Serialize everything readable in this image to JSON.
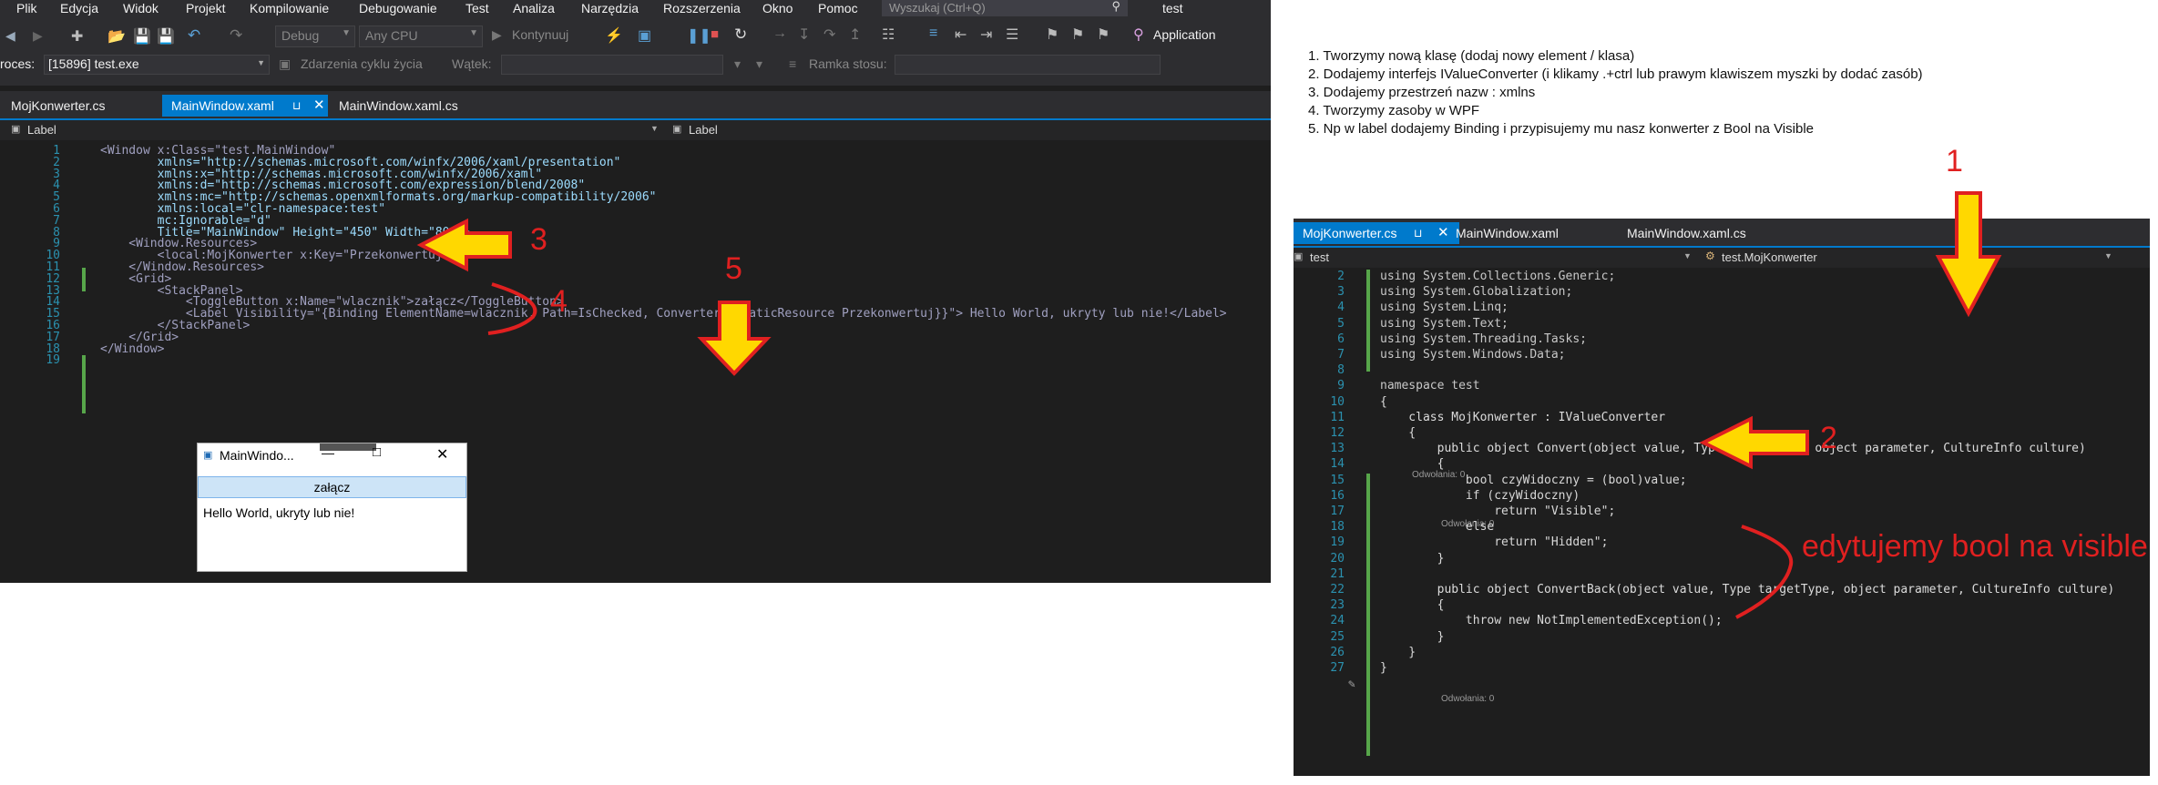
{
  "left_window": {
    "menu": [
      "Plik",
      "Edycja",
      "Widok",
      "Projekt",
      "Kompilowanie",
      "Debugowanie",
      "Test",
      "Analiza",
      "Narzędzia",
      "Rozszerzenia",
      "Okno",
      "Pomoc"
    ],
    "search_placeholder": "Wyszukaj (Ctrl+Q)",
    "solution_name": "test",
    "toolbar": {
      "config": "Debug",
      "platform": "Any CPU",
      "continue": "Kontynuuj",
      "startup": "Application"
    },
    "toolbar2": {
      "process_label": "roces:",
      "process_value": "[15896] test.exe",
      "lifecycle": "Zdarzenia cyklu życia",
      "thread_label": "Wątek:",
      "stack_frame_label": "Ramka stosu:"
    },
    "tabs": [
      "MojKonwerter.cs",
      "MainWindow.xaml",
      "MainWindow.xaml.cs"
    ],
    "active_tab": "MainWindow.xaml",
    "nav_left": "Label",
    "nav_right": "Label",
    "line_numbers": [
      "1",
      "2",
      "3",
      "4",
      "5",
      "6",
      "7",
      "8",
      "9",
      "10",
      "11",
      "12",
      "13",
      "14",
      "15",
      "16",
      "17",
      "18",
      "19"
    ],
    "code_lines": [
      "<Window x:Class=\"test.MainWindow\"",
      "        xmlns=\"http://schemas.microsoft.com/winfx/2006/xaml/presentation\"",
      "        xmlns:x=\"http://schemas.microsoft.com/winfx/2006/xaml\"",
      "        xmlns:d=\"http://schemas.microsoft.com/expression/blend/2008\"",
      "        xmlns:mc=\"http://schemas.openxmlformats.org/markup-compatibility/2006\"",
      "        xmlns:local=\"clr-namespace:test\"",
      "        mc:Ignorable=\"d\"",
      "        Title=\"MainWindow\" Height=\"450\" Width=\"800\">",
      "    <Window.Resources>",
      "        <local:MojKonwerter x:Key=\"Przekonwertuj\"/>",
      "    </Window.Resources>",
      "    <Grid>",
      "        <StackPanel>",
      "            <ToggleButton x:Name=\"wlacznik\">załącz</ToggleButton>",
      "            <Label Visibility=\"{Binding ElementName=wlacznik, Path=IsChecked, Converter={StaticResource Przekonwertuj}}\"> Hello World, ukryty lub nie!</Label>",
      "        </StackPanel>",
      "    </Grid>",
      "</Window>",
      ""
    ],
    "preview_window": {
      "title": "MainWindo...",
      "toggle_label": "załącz",
      "label_text": "Hello World, ukryty lub nie!"
    }
  },
  "instructions": [
    "1. Tworzymy nową klasę (dodaj nowy element / klasa)",
    "2. Dodajemy interfejs IValueConverter (i klikamy .+ctrl lub prawym klawiszem myszki by dodać zasób)",
    "3. Dodajemy przestrzeń  nazw : xmlns",
    "4. Tworzymy zasoby w WPF",
    "5. Np w label dodajemy Binding i przypisujemy mu nasz konwerter z Bool na Visible"
  ],
  "right_window": {
    "tabs": [
      "MojKonwerter.cs",
      "MainWindow.xaml",
      "MainWindow.xaml.cs"
    ],
    "active_tab": "MojKonwerter.cs",
    "nav_left": "test",
    "nav_right": "test.MojKonwerter",
    "references_label": "Odwołania: 0",
    "line_numbers": [
      "2",
      "3",
      "4",
      "5",
      "6",
      "7",
      "8",
      "9",
      "10",
      "11",
      "12",
      "13",
      "14",
      "15",
      "16",
      "17",
      "18",
      "19",
      "20",
      "21",
      "22",
      "23",
      "24",
      "25",
      "26",
      "27"
    ],
    "code_lines": [
      "using System.Collections.Generic;",
      "using System.Globalization;",
      "using System.Linq;",
      "using System.Text;",
      "using System.Threading.Tasks;",
      "using System.Windows.Data;",
      "",
      "namespace test",
      "{",
      "    class MojKonwerter : IValueConverter",
      "    {",
      "        public object Convert(object value, Type targetType, object parameter, CultureInfo culture)",
      "        {",
      "            bool czyWidoczny = (bool)value;",
      "            if (czyWidoczny)",
      "                return \"Visible\";",
      "            else",
      "                return \"Hidden\";",
      "        }",
      "",
      "        public object ConvertBack(object value, Type targetType, object parameter, CultureInfo culture)",
      "        {",
      "            throw new NotImplementedException();",
      "        }",
      "    }",
      "}"
    ]
  },
  "annotations": {
    "n1": "1",
    "n2": "2",
    "n3": "3",
    "n4": "4",
    "n5": "5",
    "note": "edytujemy bool na visible",
    "color": "#e02020",
    "arrow_color": "#ffd800"
  }
}
